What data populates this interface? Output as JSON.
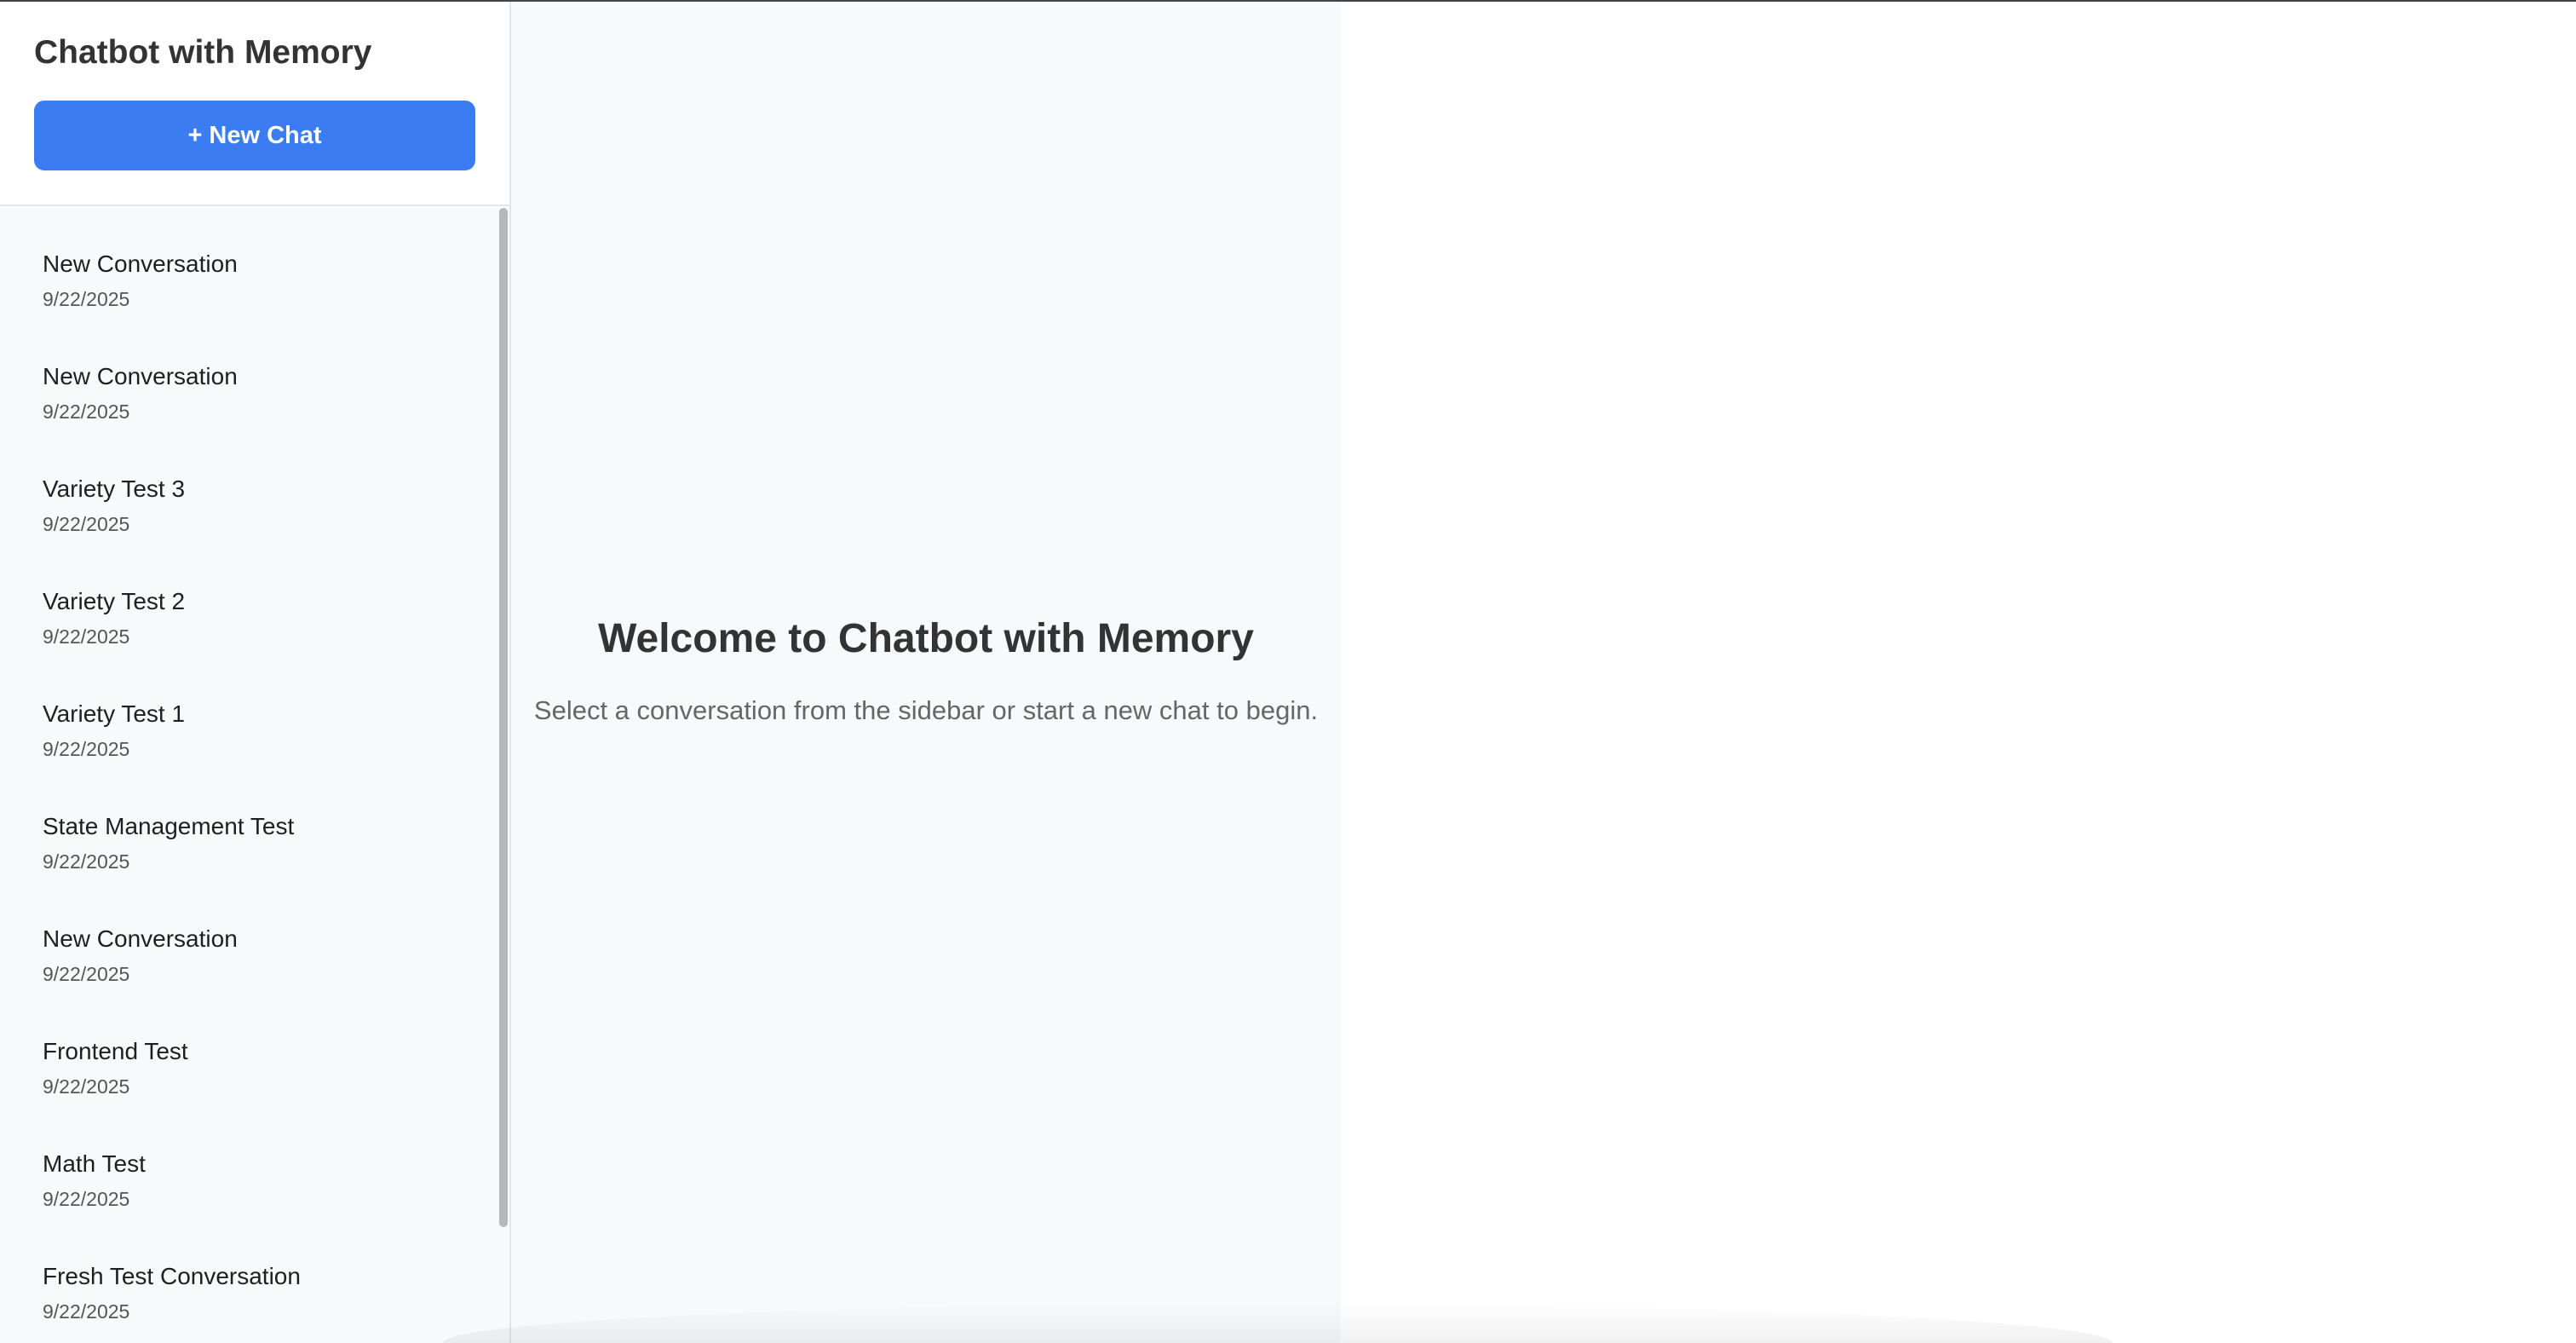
{
  "app": {
    "title": "Chatbot with Memory",
    "accent_color": "#3b7cf2"
  },
  "sidebar": {
    "new_chat_label": "+ New Chat",
    "conversations": [
      {
        "title": "New Conversation",
        "date": "9/22/2025"
      },
      {
        "title": "New Conversation",
        "date": "9/22/2025"
      },
      {
        "title": "Variety Test 3",
        "date": "9/22/2025"
      },
      {
        "title": "Variety Test 2",
        "date": "9/22/2025"
      },
      {
        "title": "Variety Test 1",
        "date": "9/22/2025"
      },
      {
        "title": "State Management Test",
        "date": "9/22/2025"
      },
      {
        "title": "New Conversation",
        "date": "9/22/2025"
      },
      {
        "title": "Frontend Test",
        "date": "9/22/2025"
      },
      {
        "title": "Math Test",
        "date": "9/22/2025"
      },
      {
        "title": "Fresh Test Conversation",
        "date": "9/22/2025"
      }
    ]
  },
  "main": {
    "welcome_title": "Welcome to Chatbot with Memory",
    "welcome_subtitle": "Select a conversation from the sidebar or start a new chat to begin."
  }
}
